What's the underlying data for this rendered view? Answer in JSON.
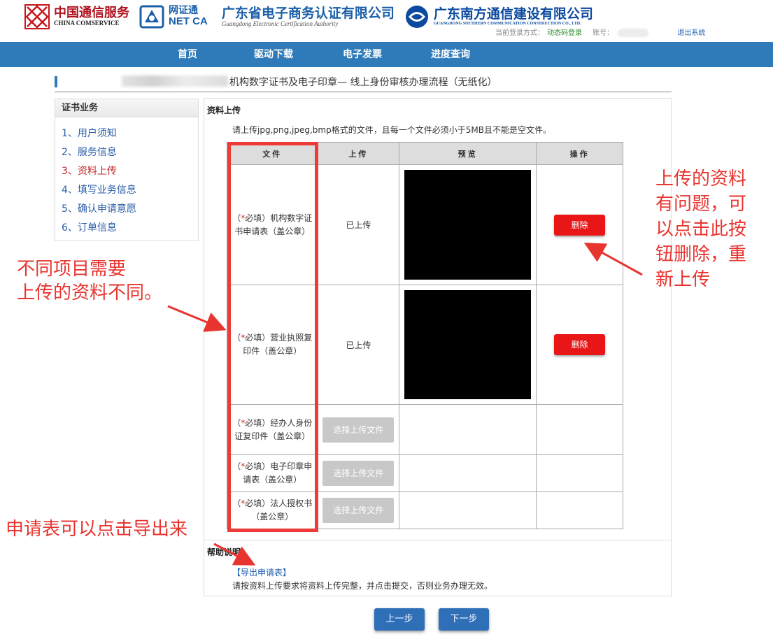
{
  "header": {
    "logos": [
      {
        "name": "中国通信服务",
        "sub": "CHINA COMSERVICE"
      },
      {
        "name": "网证通",
        "sub": "NET CA"
      },
      {
        "name": "广东省电子商务认证有限公司",
        "sub": "Guangdong Electronic Certification Authority"
      },
      {
        "name": "广东南方通信建设有限公司",
        "sub": "GUANGDONG SOUTHERN COMMUNICATION CONSTRUCTION CO., LTD."
      }
    ],
    "login_method_label": "当前登录方式：",
    "login_method": "动态码登录",
    "account_label": "账号：",
    "logout": "退出系统"
  },
  "nav": [
    {
      "label": "首页"
    },
    {
      "label": "驱动下载"
    },
    {
      "label": "电子发票"
    },
    {
      "label": "进度查询"
    }
  ],
  "page_title": "机构数字证书及电子印章— 线上身份审核办理流程（无纸化）",
  "sidebar": {
    "title": "证书业务",
    "items": [
      {
        "label": "1、用户须知",
        "active": false
      },
      {
        "label": "2、服务信息",
        "active": false
      },
      {
        "label": "3、资料上传",
        "active": true
      },
      {
        "label": "4、填写业务信息",
        "active": false
      },
      {
        "label": "5、确认申请意愿",
        "active": false
      },
      {
        "label": "6、订单信息",
        "active": false
      }
    ]
  },
  "upload": {
    "section_title": "资料上传",
    "hint": "请上传jpg,png,jpeg,bmp格式的文件，且每一个文件必须小于5MB且不能是空文件。",
    "columns": [
      "文件",
      "上传",
      "预览",
      "操作"
    ],
    "required_mark": "*",
    "rows": [
      {
        "prefix": "（",
        "suffix": "必填）机构数字证书申请表（盖公章）",
        "status": "已上传",
        "has_preview": true,
        "action": "删除"
      },
      {
        "prefix": "（",
        "suffix": "必填）营业执照复印件（盖公章）",
        "status": "已上传",
        "has_preview": true,
        "action": "删除"
      },
      {
        "prefix": "（",
        "suffix": "必填）经办人身份证复印件（盖公章）",
        "status": "",
        "choose": "选择上传文件",
        "has_preview": false,
        "action": ""
      },
      {
        "prefix": "（",
        "suffix": "必填）电子印章申请表（盖公章）",
        "status": "",
        "choose": "选择上传文件",
        "has_preview": false,
        "action": ""
      },
      {
        "prefix": "（",
        "suffix": "必填）法人授权书（盖公章）",
        "status": "",
        "choose": "选择上传文件",
        "has_preview": false,
        "action": ""
      }
    ]
  },
  "help": {
    "title": "帮助说明",
    "export_link": "【导出申请表】",
    "text": "请按资料上传要求将资料上传完整，并点击提交，否则业务办理无效。"
  },
  "buttons": {
    "prev": "上一步",
    "next": "下一步"
  },
  "annotations": {
    "left": [
      "不同项目需要",
      "上传的资料不同。"
    ],
    "right": [
      "上传的资料",
      "有问题，可",
      "以点击此按",
      "钮删除，重",
      "新上传"
    ],
    "bottom": "申请表可以点击导出来"
  },
  "colors": {
    "nav": "#2f7ab8",
    "annotation": "#e8342f",
    "delete": "#e81616",
    "link": "#1f5fb0"
  }
}
